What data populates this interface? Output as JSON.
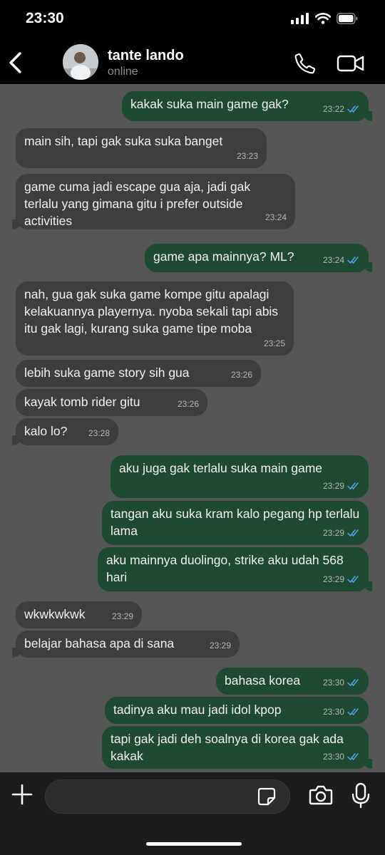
{
  "status_bar": {
    "time": "23:30"
  },
  "header": {
    "contact_name": "tante lando",
    "status": "online"
  },
  "messages": [
    {
      "dir": "out",
      "text": "kakak suka main game gak?",
      "time": "23:22",
      "read": true
    },
    {
      "dir": "in",
      "text": "main sih, tapi gak suka suka banget",
      "time": "23:23"
    },
    {
      "dir": "in",
      "text": "game cuma jadi escape gua aja, jadi gak terlalu yang gimana gitu i prefer outside activities",
      "time": "23:24"
    },
    {
      "dir": "out",
      "text": "game apa mainnya? ML?",
      "time": "23:24",
      "read": true
    },
    {
      "dir": "in",
      "text": "nah, gua gak suka game kompe gitu apalagi kelakuannya playernya. nyoba sekali tapi abis itu gak lagi, kurang suka game tipe moba",
      "time": "23:25"
    },
    {
      "dir": "in",
      "text": "lebih suka game story sih gua",
      "time": "23:26"
    },
    {
      "dir": "in",
      "text": "kayak tomb rider gitu",
      "time": "23:26"
    },
    {
      "dir": "in",
      "text": "kalo lo?",
      "time": "23:28"
    },
    {
      "dir": "out",
      "text": "aku juga gak terlalu suka main game",
      "time": "23:29",
      "read": true
    },
    {
      "dir": "out",
      "text": "tangan aku suka kram kalo pegang hp terlalu lama",
      "time": "23:29",
      "read": true
    },
    {
      "dir": "out",
      "text": "aku mainnya duolingo, strike aku udah 568 hari",
      "time": "23:29",
      "read": true
    },
    {
      "dir": "in",
      "text": "wkwkwkwk",
      "time": "23:29"
    },
    {
      "dir": "in",
      "text": "belajar bahasa apa di sana",
      "time": "23:29"
    },
    {
      "dir": "out",
      "text": "bahasa korea",
      "time": "23:30",
      "read": true
    },
    {
      "dir": "out",
      "text": "tadinya aku mau jadi idol kpop",
      "time": "23:30",
      "read": true
    },
    {
      "dir": "out",
      "text": "tapi gak jadi deh soalnya di korea gak ada kakak",
      "time": "23:30",
      "read": true
    }
  ],
  "input": {
    "placeholder": ""
  },
  "icons": {
    "back": "chevron-left-icon",
    "call": "phone-icon",
    "video": "video-camera-icon",
    "attach": "plus-icon",
    "sticker": "sticker-icon",
    "camera": "camera-icon",
    "mic": "microphone-icon",
    "read_receipt": "double-check-icon"
  },
  "colors": {
    "chat_background": "#565656",
    "incoming_bubble": "#3e3e3f",
    "outgoing_bubble": "#1e4a33",
    "read_tick": "#4fa6e8"
  }
}
